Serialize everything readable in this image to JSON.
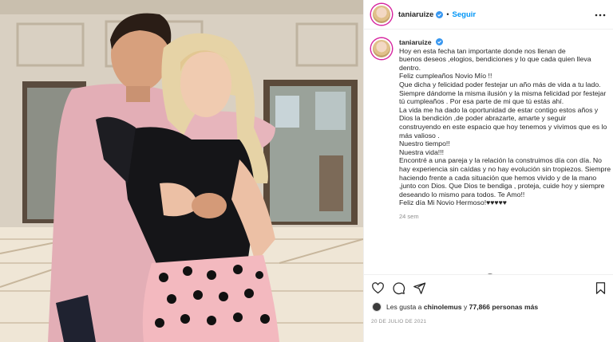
{
  "post": {
    "username": "taniaruize",
    "follow_label": "Seguir",
    "separator": "•",
    "caption_lines": [
      "Hoy en esta fecha tan importante donde nos llenan de",
      "buenos deseos ,elogios, bendiciones y lo que cada quien lleva",
      "dentro.",
      "Feliz cumpleaños Novio Mío !!",
      "Que dicha y felicidad poder festejar un año más de vida a tu lado.",
      "Siempre dándome la misma ilusión y la misma felicidad por festejar",
      "tú cumpleaños . Por esa parte de mi que tú estás ahí.",
      "La vida me ha dado la oportunidad de estar contigo estos años y",
      "Dios la bendición ,de poder abrazarte, amarte y seguir",
      "construyendo en este espacio que hoy tenemos y vivimos que es lo",
      "más valioso .",
      "Nuestro tiempo!!",
      "Nuestra vida!!!",
      "Encontré a una pareja y la relación la construimos día con día. No",
      "hay experiencia sin caídas y no hay evolución sin tropiezos. Siempre",
      "haciendo frente a cada situación que hemos vivido y de la mano",
      ",junto con Dios. Que Dios te bendiga , proteja, cuide hoy y siempre",
      "deseando lo mismo para todos. Te Amo!!",
      "Feliz día Mi Novio Hermoso!♥♥♥♥♥"
    ],
    "time_ago": "24 sem",
    "likes_prefix": "Les gusta a",
    "likes_user": "chinolemus",
    "likes_joiner": "y",
    "likes_count": "77,866 personas más",
    "date": "20 DE JULIO DE 2021"
  },
  "icons": {
    "verified": "verified-badge-icon",
    "more": "more-options-icon",
    "load_more": "plus-circle-icon",
    "like": "heart-icon",
    "comment": "comment-icon",
    "share": "paper-plane-icon",
    "save": "bookmark-icon"
  },
  "colors": {
    "link_blue": "#0095f6",
    "verified_blue": "#3897f0",
    "text": "#262626",
    "muted": "#8e8e8e",
    "border": "#efefef"
  }
}
